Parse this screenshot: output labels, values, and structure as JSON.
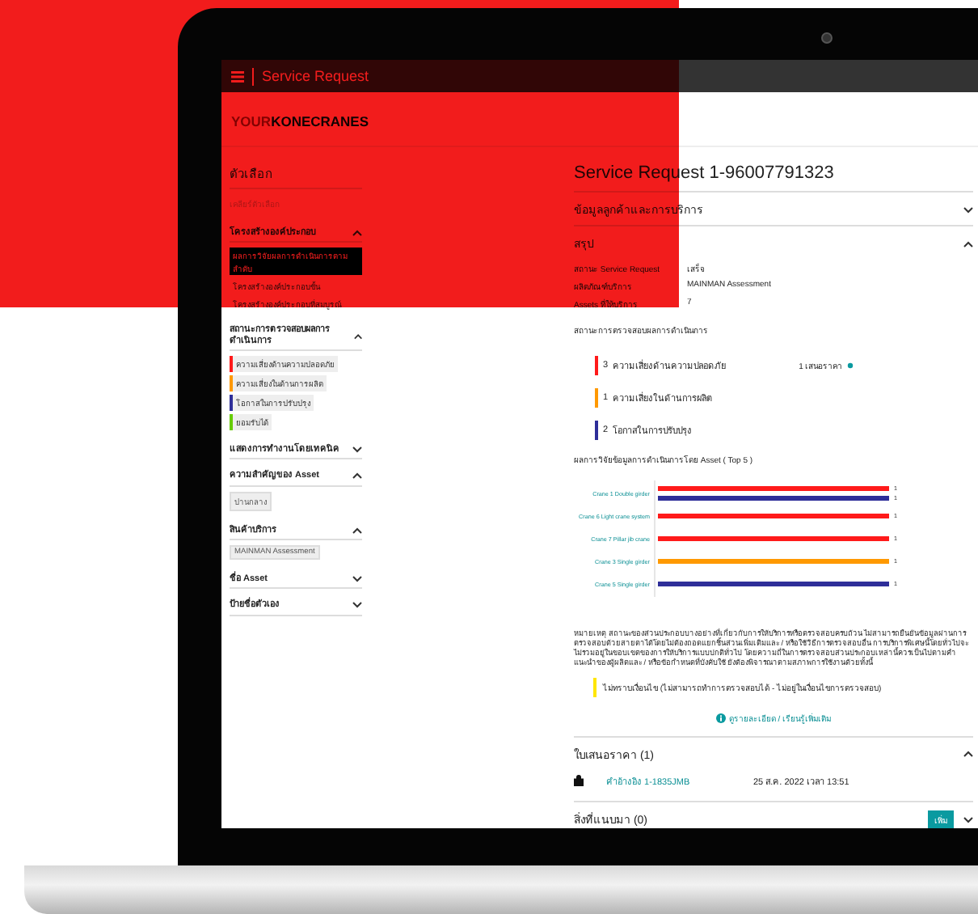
{
  "top_bar": {
    "title": "Service Request"
  },
  "logo": {
    "prefix": "YOUR",
    "name": "KONECRANES"
  },
  "sidebar": {
    "title": "ตัวเลือก",
    "clear": "เคลียร์ตัวเลือก",
    "sections": [
      {
        "title": "โครงสร้างองค์ประกอบ",
        "expanded": true,
        "kind": "links",
        "items": [
          {
            "label": "ผลการวิจัยผลการดำเนินการตามลำดับ",
            "selected": true
          },
          {
            "label": "โครงสร้างองค์ประกอบขั้น",
            "selected": false
          },
          {
            "label": "โครงสร้างองค์ประกอบที่สมบูรณ์",
            "selected": false
          }
        ]
      },
      {
        "title": "สถานะการตรวจสอบผลการดำเนินการ",
        "expanded": true,
        "kind": "legend",
        "items": [
          {
            "label": "ความเสี่ยงด้านความปลอดภัย",
            "color": "#ff1a1a"
          },
          {
            "label": "ความเสี่ยงในด้านการผลิต",
            "color": "#ff9900"
          },
          {
            "label": "โอกาสในการปรับปรุง",
            "color": "#2e2e99"
          },
          {
            "label": "ยอมรับได้",
            "color": "#66cc00"
          }
        ]
      },
      {
        "title": "แสดงการทำงานโดยเทคนิค",
        "expanded": false
      },
      {
        "title": "ความสำคัญของ Asset",
        "expanded": true,
        "kind": "chips",
        "items": [
          {
            "label": "ปานกลาง"
          }
        ]
      },
      {
        "title": "สินค้าบริการ",
        "expanded": true,
        "kind": "chips",
        "items": [
          {
            "label": "MAINMAN Assessment"
          }
        ]
      },
      {
        "title": "ชื่อ Asset",
        "expanded": false
      },
      {
        "title": "ป้ายชื่อตัวเอง",
        "expanded": false
      }
    ]
  },
  "main": {
    "title": "Service Request 1-96007791323",
    "customer_panel": {
      "title": "ข้อมูลลูกค้าและการบริการ",
      "expanded": false
    },
    "summary": {
      "title": "สรุป",
      "expanded": true,
      "rows": [
        {
          "label": "สถานะ Service Request",
          "value": "เสร็จ"
        },
        {
          "label": "ผลิตภัณฑ์บริการ",
          "value": "MAINMAN Assessment"
        },
        {
          "label": "Assets ที่ให้บริการ",
          "value": "7"
        }
      ],
      "status_title": "สถานะการตรวจสอบผลการดำเนินการ",
      "findings": [
        {
          "count": "3",
          "label": "ความเสี่ยงด้านความปลอดภัย",
          "color": "#ff1a1a",
          "quote": "1 เสนอราคา"
        },
        {
          "count": "1",
          "label": "ความเสี่ยงในด้านการผลิต",
          "color": "#ff9900"
        },
        {
          "count": "2",
          "label": "โอกาสในการปรับปรุง",
          "color": "#2e2e99"
        }
      ],
      "chart_title": "ผลการวิจัยข้อมูลการดำเนินการโดย Asset ( Top 5 )",
      "chart_data": {
        "type": "bar",
        "orientation": "horizontal",
        "categories": [
          "Crane 1 Double girder",
          "Crane 6 Light crane system",
          "Crane 7 Pillar jib crane",
          "Crane 3 Single girder",
          "Crane 5 Single girder"
        ],
        "series": [
          {
            "color": "#ff1a1a",
            "values": [
              1,
              1,
              1,
              null,
              null
            ]
          },
          {
            "color": "#ff9900",
            "values": [
              null,
              null,
              null,
              1,
              null
            ]
          },
          {
            "color": "#2e2e99",
            "values": [
              1,
              null,
              null,
              null,
              1
            ]
          }
        ],
        "data_labels": true
      },
      "note": "หมายเหตุ สถานะของส่วนประกอบบางอย่างที่เกี่ยวกับการให้บริการหรือตรวจสอบครบถ้วน ไม่สามารถยืนยันข้อมูลผ่านการตรวจสอบด้วยสายตาได้โดยไม่ต้องถอดแยกชิ้นส่วนเพิ่มเติมและ / หรือใช้วิธีการตรวจสอบอื่น การบริการพิเศษนี้โดยทั่วไปจะไม่รวมอยู่ในขอบเขตของการให้บริการแบบปกติทั่วไป โดยความถี่ในการตรวจสอบส่วนประกอบเหล่านี้ควรเป็นไปตามคำแนะนำของผู้ผลิตและ / หรือข้อกำหนดที่บังคับใช้ ยังต้องพิจารณาตามสภาพการใช้งานด้วยทั้งนี้",
      "unknown_status": "ไม่ทราบเงื่อนไข (ไม่สามารถทำการตรวจสอบได้ - ไม่อยู่ในเงื่อนไขการตรวจสอบ)",
      "learn_more": "ดูรายละเอียด / เรียนรู้เพิ่มเติม"
    },
    "quotes": {
      "title": "ใบเสนอราคา (1)",
      "expanded": true,
      "rows": [
        {
          "reference": "คำอ้างอิง 1-1835JMB",
          "date": "25 ส.ค. 2022 เวลา 13:51"
        }
      ]
    },
    "attachments": {
      "title": "สิ่งที่แนบมา (0)",
      "expanded": false,
      "add_button": "เพิ่ม"
    }
  }
}
